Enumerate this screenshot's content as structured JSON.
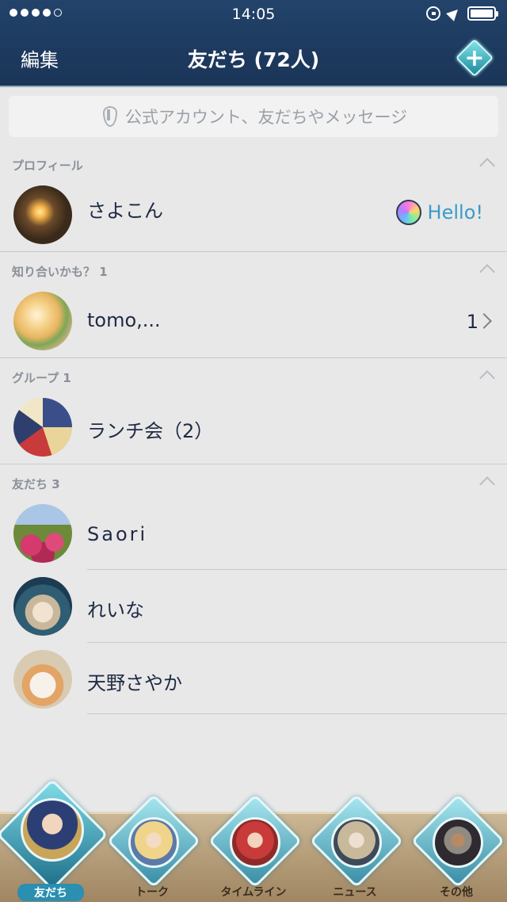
{
  "status_bar": {
    "time": "14:05",
    "signal_dots_filled": 4,
    "signal_dots_total": 5
  },
  "header": {
    "edit_label": "編集",
    "title": "友だち (72人)"
  },
  "search": {
    "placeholder": "公式アカウント、友だちやメッセージ"
  },
  "sections": {
    "profile": {
      "label": "プロフィール"
    },
    "suggested": {
      "label": "知り合いかも？ 1"
    },
    "groups": {
      "label": "グループ 1"
    },
    "friends": {
      "label": "友だち 3"
    }
  },
  "profile": {
    "name": "さよこん",
    "status_message": "Hello!"
  },
  "suggested": {
    "name": "tomo,...",
    "count": "1"
  },
  "groups": [
    {
      "name": "ランチ会（2）"
    }
  ],
  "friends": [
    {
      "name": "Saori"
    },
    {
      "name": "れいな"
    },
    {
      "name": "天野さやか"
    }
  ],
  "tabbar": {
    "tabs": [
      {
        "label": "友だち",
        "active": true
      },
      {
        "label": "トーク",
        "active": false
      },
      {
        "label": "タイムライン",
        "active": false
      },
      {
        "label": "ニュース",
        "active": false
      },
      {
        "label": "その他",
        "active": false
      }
    ]
  },
  "colors": {
    "header_bg": "#1d3a5e",
    "accent_link": "#3a9bc6",
    "tab_active": "#2a8fb0"
  }
}
